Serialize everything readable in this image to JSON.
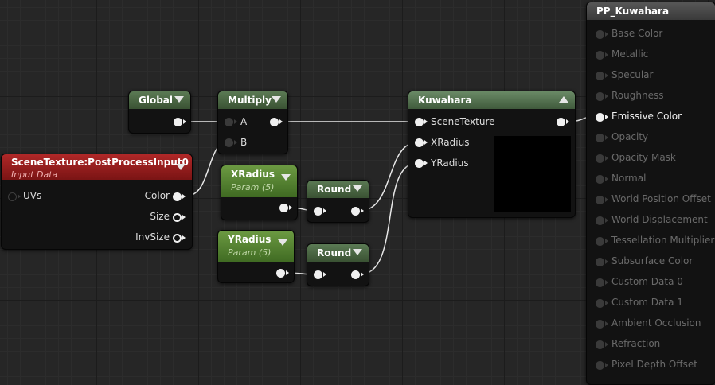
{
  "nodes": {
    "global": {
      "title": "Global"
    },
    "multiply": {
      "title": "Multiply",
      "pins": {
        "a": "A",
        "b": "B"
      }
    },
    "scene_texture": {
      "title": "SceneTexture:PostProcessInput0",
      "subtitle": "Input Data",
      "pins": {
        "uvs": "UVs",
        "color": "Color",
        "size": "Size",
        "invsize": "InvSize"
      }
    },
    "xradius": {
      "title": "XRadius",
      "subtitle": "Param (5)"
    },
    "yradius": {
      "title": "YRadius",
      "subtitle": "Param (5)"
    },
    "round_x": {
      "title": "Round"
    },
    "round_y": {
      "title": "Round"
    },
    "kuwahara": {
      "title": "Kuwahara",
      "pins": {
        "scene_texture": "SceneTexture",
        "xradius": "XRadius",
        "yradius": "YRadius"
      }
    }
  },
  "material": {
    "title": "PP_Kuwahara",
    "inputs": [
      {
        "label": "Base Color",
        "active": false
      },
      {
        "label": "Metallic",
        "active": false
      },
      {
        "label": "Specular",
        "active": false
      },
      {
        "label": "Roughness",
        "active": false
      },
      {
        "label": "Emissive Color",
        "active": true
      },
      {
        "label": "Opacity",
        "active": false
      },
      {
        "label": "Opacity Mask",
        "active": false
      },
      {
        "label": "Normal",
        "active": false
      },
      {
        "label": "World Position Offset",
        "active": false
      },
      {
        "label": "World Displacement",
        "active": false
      },
      {
        "label": "Tessellation Multiplier",
        "active": false
      },
      {
        "label": "Subsurface Color",
        "active": false
      },
      {
        "label": "Custom Data 0",
        "active": false
      },
      {
        "label": "Custom Data 1",
        "active": false
      },
      {
        "label": "Ambient Occlusion",
        "active": false
      },
      {
        "label": "Refraction",
        "active": false
      },
      {
        "label": "Pixel Depth Offset",
        "active": false
      }
    ]
  }
}
